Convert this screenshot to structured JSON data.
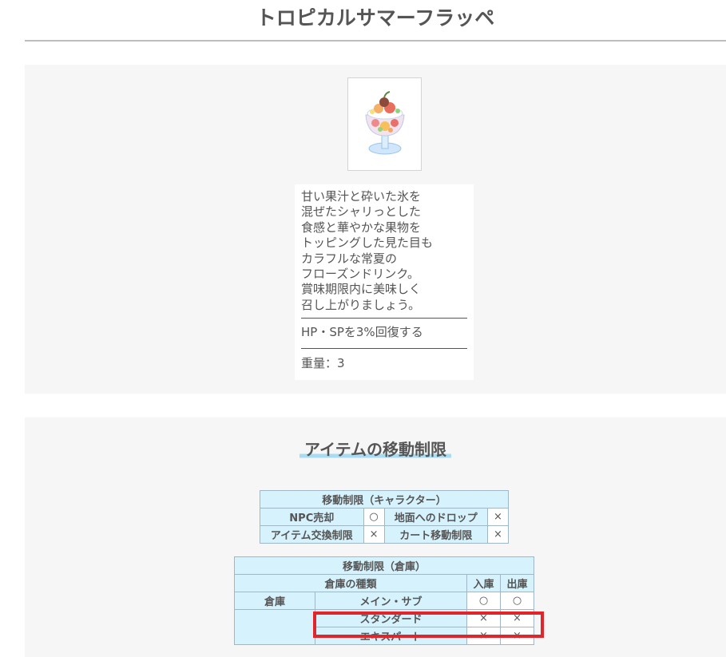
{
  "page": {
    "title": "トロピカルサマーフラッペ"
  },
  "item": {
    "image_icon": "frappe-parfait-icon",
    "description_lines": [
      "甘い果汁と砕いた氷を",
      "混ぜたシャリっとした",
      "食感と華やかな果物を",
      "トッピングした見た目も",
      "カラフルな常夏の",
      "フローズンドリンク。",
      "賞味期限内に美味しく",
      "召し上がりましょう。"
    ],
    "effect": "HP・SPを3%回復する",
    "weight": "重量：3"
  },
  "move_restrictions": {
    "heading": "アイテムの移動制限",
    "character": {
      "title": "移動制限（キャラクター）",
      "rows": [
        {
          "label_a": "NPC売却",
          "value_a": "○",
          "label_b": "地面へのドロップ",
          "value_b": "×"
        },
        {
          "label_a": "アイテム交換制限",
          "value_a": "×",
          "label_b": "カート移動制限",
          "value_b": "×"
        }
      ]
    },
    "storage": {
      "title": "移動制限（倉庫）",
      "col_type": "倉庫の種類",
      "col_in": "入庫",
      "col_out": "出庫",
      "group_label": "倉庫",
      "rows": [
        {
          "name": "メイン・サブ",
          "in": "○",
          "out": "○"
        },
        {
          "name": "スタンダード",
          "in": "×",
          "out": "×"
        },
        {
          "name": "エキスパート",
          "in": "×",
          "out": "×"
        }
      ]
    }
  },
  "colors": {
    "header_cell": "#d6f2fc",
    "highlight": "#e0262b",
    "heading_underline": "#a8dcf2"
  }
}
